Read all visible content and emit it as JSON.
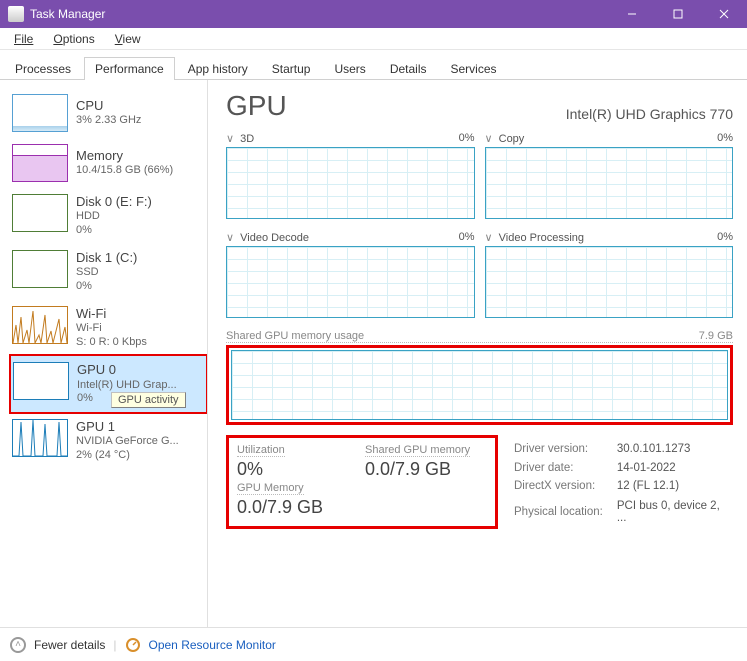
{
  "window": {
    "title": "Task Manager"
  },
  "menu": {
    "file": "File",
    "options": "Options",
    "view": "View"
  },
  "tabs": [
    "Processes",
    "Performance",
    "App history",
    "Startup",
    "Users",
    "Details",
    "Services"
  ],
  "active_tab_index": 1,
  "sidebar": [
    {
      "label": "CPU",
      "meta": "3%  2.33 GHz",
      "graph_class": "g-cpu"
    },
    {
      "label": "Memory",
      "meta": "10.4/15.8 GB (66%)",
      "graph_class": "g-mem"
    },
    {
      "label": "Disk 0 (E: F:)",
      "second": "HDD",
      "meta": "0%",
      "graph_class": "g-disk0"
    },
    {
      "label": "Disk 1 (C:)",
      "second": "SSD",
      "meta": "0%",
      "graph_class": "g-disk1"
    },
    {
      "label": "Wi-Fi",
      "second": "Wi-Fi",
      "meta": "S: 0  R: 0 Kbps",
      "graph_class": "g-wifi"
    },
    {
      "label": "GPU 0",
      "second": "Intel(R) UHD Grap...",
      "meta": "0%",
      "graph_class": "g-gpu0",
      "selected": true,
      "tooltip": "GPU activity"
    },
    {
      "label": "GPU 1",
      "second": "NVIDIA GeForce G...",
      "meta": "2% (24 °C)",
      "graph_class": "g-gpu1"
    }
  ],
  "main": {
    "title": "GPU",
    "subtitle": "Intel(R) UHD Graphics 770",
    "charts_row1": [
      {
        "name": "3D",
        "pct": "0%"
      },
      {
        "name": "Copy",
        "pct": "0%"
      }
    ],
    "charts_row2": [
      {
        "name": "Video Decode",
        "pct": "0%"
      },
      {
        "name": "Video Processing",
        "pct": "0%"
      }
    ],
    "shared": {
      "label": "Shared GPU memory usage",
      "max": "7.9 GB"
    },
    "stats": {
      "util_label": "Utilization",
      "util_val": "0%",
      "smem_label": "Shared GPU memory",
      "smem_val": "0.0/7.9 GB",
      "gpum_label": "GPU Memory",
      "gpum_val": "0.0/7.9 GB"
    },
    "driver": {
      "version_l": "Driver version:",
      "version": "30.0.101.1273",
      "date_l": "Driver date:",
      "date": "14-01-2022",
      "dx_l": "DirectX version:",
      "dx": "12 (FL 12.1)",
      "loc_l": "Physical location:",
      "loc": "PCI bus 0, device 2, ..."
    }
  },
  "footer": {
    "fewer": "Fewer details",
    "orm": "Open Resource Monitor"
  }
}
